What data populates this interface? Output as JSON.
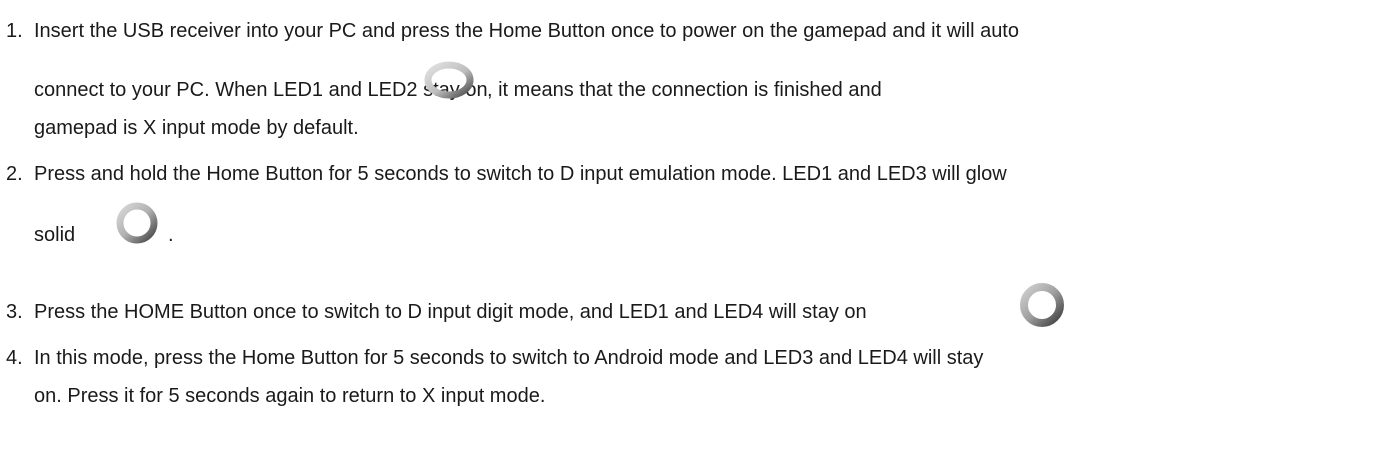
{
  "instructions": [
    {
      "number": "1.",
      "lines": [
        "Insert the USB receiver into your PC and press the Home Button once to power on the gamepad and it will auto",
        "connect to your PC. When LED1 and LED2 stay on",
        ", it means that the connection is finished and",
        "gamepad is X input mode by default."
      ],
      "led_icon": "led-ring-icon"
    },
    {
      "number": "2.",
      "lines": [
        "Press and hold the Home Button for 5 seconds to switch to D input emulation mode. LED1 and LED3 will glow",
        "solid",
        "."
      ],
      "led_icon": "led-ring-icon"
    },
    {
      "number": "3.",
      "lines": [
        "Press the HOME Button once to switch to D input digit mode, and LED1 and LED4 will stay on"
      ],
      "led_icon": "led-ring-icon"
    },
    {
      "number": "4.",
      "lines": [
        "In this mode, press the Home Button for 5 seconds to switch to Android mode and LED3 and LED4 will stay",
        "on. Press it for 5 seconds again to return to X input mode."
      ]
    }
  ],
  "colors": {
    "text": "#1a1a1a",
    "led_ring_light": "#d6d6d6",
    "led_ring_dark": "#555555"
  }
}
